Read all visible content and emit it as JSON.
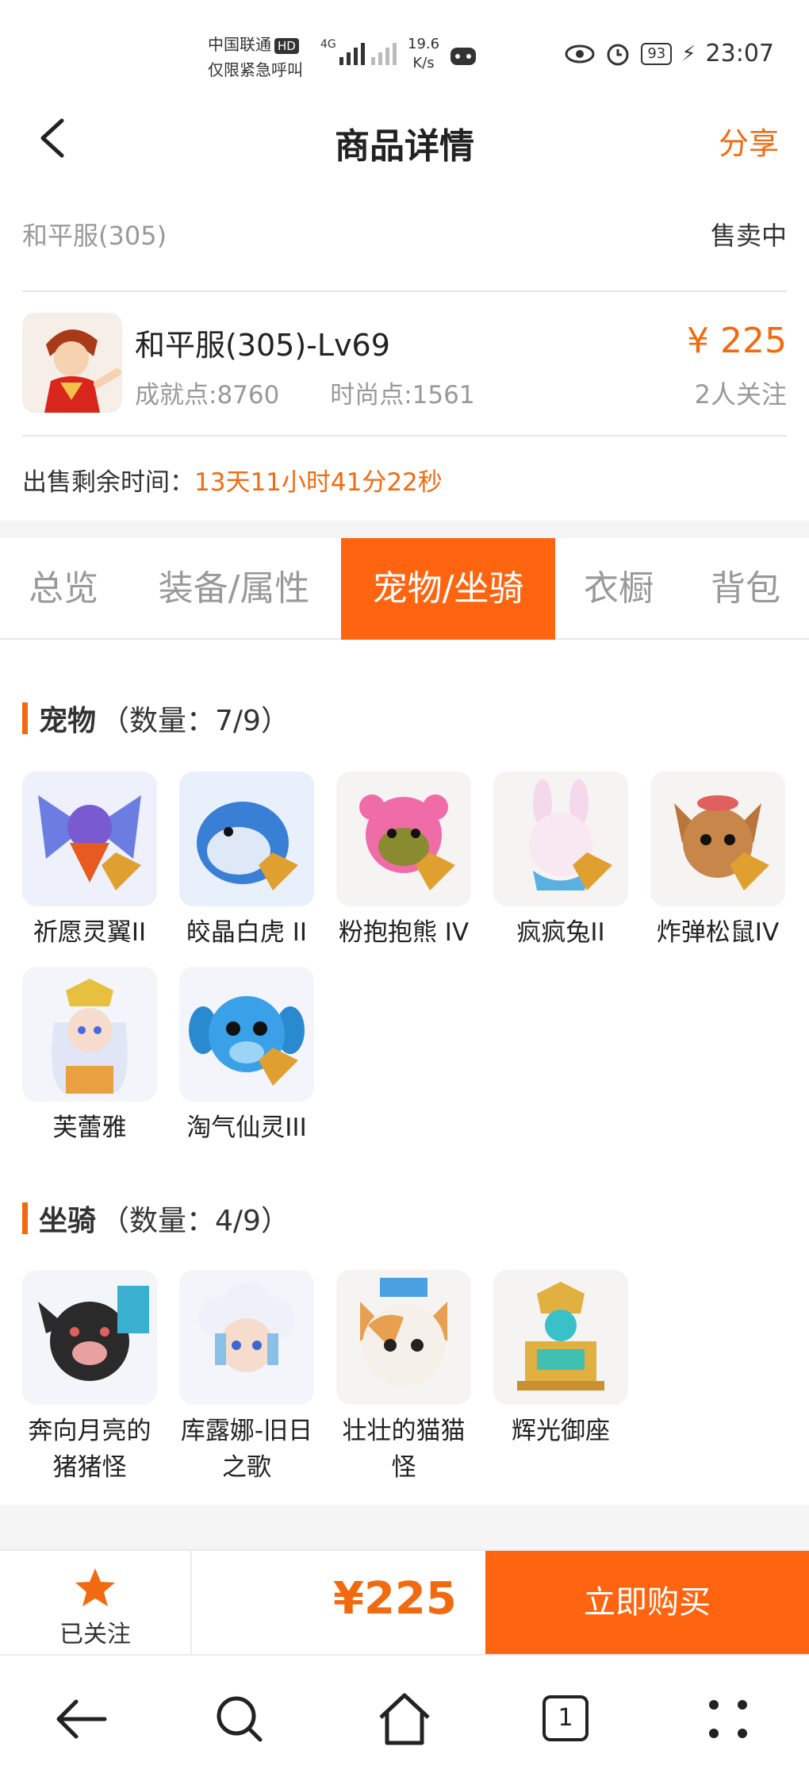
{
  "status_bar": {
    "carrier_line1": "中国联通",
    "hd": "HD",
    "carrier_line2": "仅限紧急呼叫",
    "net": "4G",
    "speed_value": "19.6",
    "speed_unit": "K/s",
    "battery": "93",
    "time": "23:07"
  },
  "nav": {
    "title": "商品详情",
    "share": "分享"
  },
  "server": {
    "name": "和平服(305)",
    "status": "售卖中"
  },
  "product": {
    "title": "和平服(305)-Lv69",
    "achievement": "成就点:8760",
    "fashion": "时尚点:1561",
    "price": "¥ 225",
    "followers": "2人关注"
  },
  "remain": {
    "label": "出售剩余时间：",
    "time": "13天11小时41分22秒"
  },
  "tabs": [
    {
      "label": "总览"
    },
    {
      "label": "装备/属性"
    },
    {
      "label": "宠物/坐骑"
    },
    {
      "label": "衣橱"
    },
    {
      "label": "背包"
    }
  ],
  "pets": {
    "title": "宠物",
    "count": "（数量：7/9）",
    "items": [
      {
        "name": "祈愿灵翼II",
        "icon": "griffin-icon",
        "color": "#5a6bd0"
      },
      {
        "name": "皎晶白虎 II",
        "icon": "white-tiger-icon",
        "color": "#3a7fd6"
      },
      {
        "name": "粉抱抱熊 IV",
        "icon": "pink-bear-icon",
        "color": "#f06ca8"
      },
      {
        "name": "疯疯兔II",
        "icon": "rabbit-icon",
        "color": "#f0a8d8"
      },
      {
        "name": "炸弹松鼠IV",
        "icon": "squirrel-icon",
        "color": "#c8864a"
      },
      {
        "name": "芙蕾雅",
        "icon": "fairy-icon",
        "color": "#9ab8f0"
      },
      {
        "name": "淘气仙灵III",
        "icon": "blue-sprite-icon",
        "color": "#3aa0e8"
      }
    ]
  },
  "mounts": {
    "title": "坐骑",
    "count": "（数量：4/9）",
    "items": [
      {
        "name": "奔向月亮的猪猪怪",
        "icon": "pig-icon",
        "color": "#2a2a2a"
      },
      {
        "name": "库露娜-旧日之歌",
        "icon": "sheep-girl-icon",
        "color": "#8ac0e8"
      },
      {
        "name": "壮壮的猫猫怪",
        "icon": "cat-icon",
        "color": "#e8a050"
      },
      {
        "name": "辉光御座",
        "icon": "throne-icon",
        "color": "#e0b040"
      }
    ]
  },
  "action_bar": {
    "followed": "已关注",
    "price": "¥225",
    "buy": "立即购买"
  },
  "sys_nav": {
    "tab_count": "1"
  }
}
